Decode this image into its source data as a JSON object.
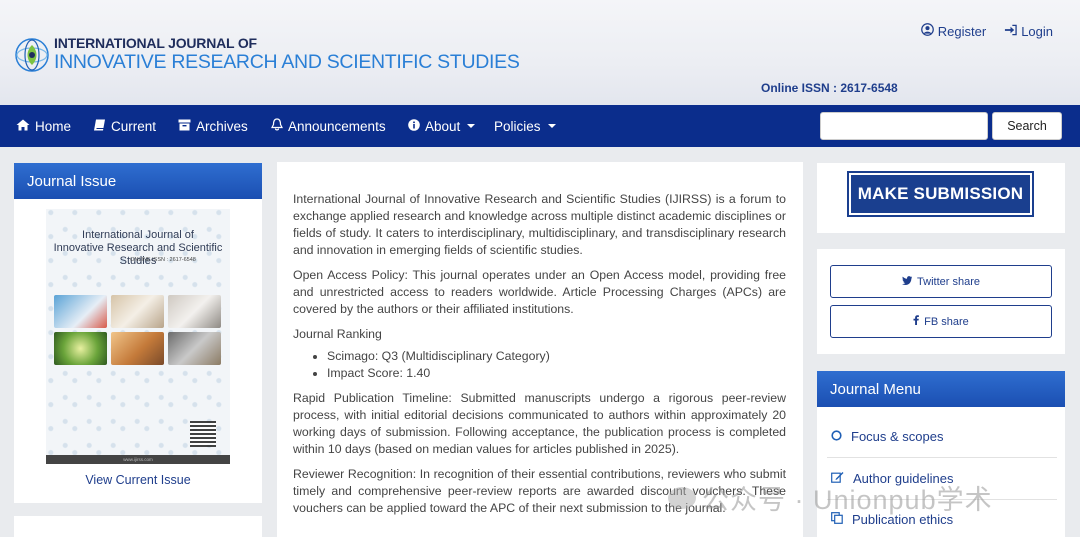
{
  "header": {
    "logo_line1": "INTERNATIONAL JOURNAL OF",
    "logo_line2": "INNOVATIVE RESEARCH AND SCIENTIFIC STUDIES",
    "register_label": "Register",
    "login_label": "Login",
    "issn": "Online ISSN : 2617-6548"
  },
  "nav": {
    "items": [
      {
        "label": "Home",
        "icon": "home-icon"
      },
      {
        "label": "Current",
        "icon": "book-icon"
      },
      {
        "label": "Archives",
        "icon": "archive-icon"
      },
      {
        "label": "Announcements",
        "icon": "bell-icon"
      },
      {
        "label": "About",
        "icon": "info-icon",
        "dropdown": true
      },
      {
        "label": "Policies",
        "dropdown": true
      }
    ],
    "search_button": "Search",
    "search_value": ""
  },
  "left_sidebar": {
    "title": "Journal Issue",
    "cover_title_line1": "International Journal of",
    "cover_title_line2": "Innovative Research and Scientific Studies",
    "cover_issn": "ONLINE ISSN : 2617-6548",
    "cover_footer": "www.ijirss.com",
    "view_current": "View Current Issue"
  },
  "main": {
    "intro": "International Journal of Innovative Research and Scientific Studies (IJIRSS) is a forum to exchange applied research and knowledge across multiple distinct academic disciplines or fields of study. It caters to interdisciplinary, multidisciplinary, and transdisciplinary research and innovation in emerging fields of scientific studies.",
    "open_access": "Open Access Policy: This journal operates under an Open Access model, providing free and unrestricted access to readers worldwide. Article Processing Charges (APCs) are covered by the authors or their affiliated institutions.",
    "ranking_heading": "Journal Ranking",
    "ranking_items": [
      "Scimago: Q3 (Multidisciplinary Category)",
      "Impact Score: 1.40"
    ],
    "rapid": "Rapid Publication Timeline: Submitted manuscripts undergo a rigorous peer-review process, with initial editorial decisions communicated to authors within approximately 20 working days of submission. Following acceptance, the publication process is completed within 10 days (based on median values for articles published in 2025).",
    "reviewer": "Reviewer Recognition: In recognition of their essential contributions, reviewers who submit timely and comprehensive peer-review reports are awarded discount vouchers. These vouchers can be applied toward the APC of their next submission to the journal."
  },
  "right_sidebar": {
    "make_submission": "MAKE SUBMISSION",
    "twitter_share": "Twitter share",
    "fb_share": "FB share",
    "menu_title": "Journal Menu",
    "menu_items": [
      {
        "label": "Focus & scopes",
        "icon": "circle-icon"
      },
      {
        "label": "Author guidelines",
        "icon": "edit-icon"
      },
      {
        "label": "Publication ethics",
        "icon": "copy-icon"
      }
    ]
  },
  "watermark": "公众号 · Unionpub学术",
  "colors": {
    "nav_bg": "#0b2d8c",
    "panel_head": "#1b4fb2",
    "link": "#1f3e8c",
    "submit_bg": "#1a3f8f"
  }
}
